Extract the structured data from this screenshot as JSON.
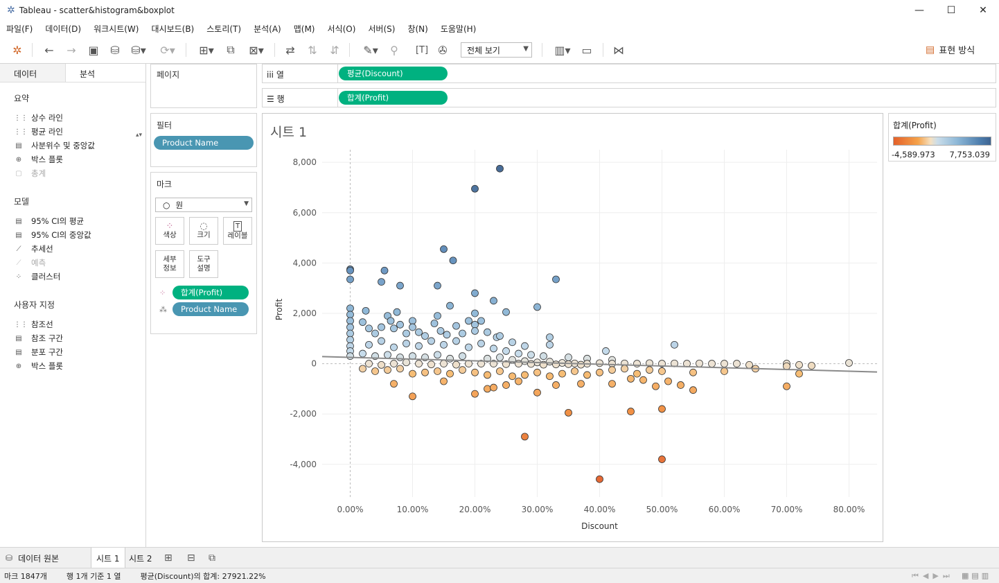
{
  "window": {
    "title": "Tableau - scatter&histogram&boxplot",
    "minimize": "—",
    "maximize": "☐",
    "close": "✕"
  },
  "menu": [
    "파일(F)",
    "데이터(D)",
    "워크시트(W)",
    "대시보드(B)",
    "스토리(T)",
    "분석(A)",
    "맵(M)",
    "서식(O)",
    "서버(S)",
    "창(N)",
    "도움말(H)"
  ],
  "toolbar": {
    "fit_label": "전체 보기",
    "showme_label": "표현 방식"
  },
  "left_pane": {
    "tabs": [
      "데이터",
      "분석"
    ],
    "sections": [
      {
        "title": "요약",
        "items": [
          {
            "label": "상수 라인",
            "enabled": true
          },
          {
            "label": "평균 라인",
            "enabled": true
          },
          {
            "label": "사분위수 및 중앙값",
            "enabled": true
          },
          {
            "label": "박스 플롯",
            "enabled": true
          },
          {
            "label": "총계",
            "enabled": false
          }
        ]
      },
      {
        "title": "모델",
        "items": [
          {
            "label": "95% CI의 평균",
            "enabled": true
          },
          {
            "label": "95% CI의 중앙값",
            "enabled": true
          },
          {
            "label": "추세선",
            "enabled": true
          },
          {
            "label": "예측",
            "enabled": false
          },
          {
            "label": "클러스터",
            "enabled": true
          }
        ]
      },
      {
        "title": "사용자 지정",
        "items": [
          {
            "label": "참조선",
            "enabled": true
          },
          {
            "label": "참조 구간",
            "enabled": true
          },
          {
            "label": "분포 구간",
            "enabled": true
          },
          {
            "label": "박스 플롯",
            "enabled": true
          }
        ]
      }
    ]
  },
  "cards": {
    "pages_title": "페이지",
    "filters_title": "필터",
    "filter_pill": "Product Name",
    "marks_title": "마크",
    "mark_type": "원",
    "mark_buttons": [
      "색상",
      "크기",
      "레이블",
      "세부\n정보",
      "도구\n설명"
    ],
    "mark_pills": [
      "합계(Profit)",
      "Product Name"
    ]
  },
  "shelves": {
    "columns_label": "열",
    "columns_pill": "평균(Discount)",
    "rows_label": "행",
    "rows_pill": "합계(Profit)"
  },
  "sheet": {
    "title": "시트 1"
  },
  "legend": {
    "title": "합계(Profit)",
    "min": "-4,589.973",
    "max": "7,753.039",
    "colors": [
      "#e4612a",
      "#f5a24a",
      "#f5e0c0",
      "#cbdde9",
      "#8fb9d8",
      "#4b7bab",
      "#3e6491"
    ]
  },
  "chart_data": {
    "type": "scatter",
    "xlabel": "Discount",
    "ylabel": "Profit",
    "xlim": [
      -0.045,
      0.845
    ],
    "ylim": [
      -5300,
      8500
    ],
    "x_ticks": [
      "0.00%",
      "10.00%",
      "20.00%",
      "30.00%",
      "40.00%",
      "50.00%",
      "60.00%",
      "70.00%",
      "80.00%"
    ],
    "x_tick_values": [
      0,
      0.1,
      0.2,
      0.3,
      0.4,
      0.5,
      0.6,
      0.7,
      0.8
    ],
    "y_ticks": [
      "8,000",
      "6,000",
      "4,000",
      "2,000",
      "0",
      "-2,000",
      "-4,000"
    ],
    "y_tick_values": [
      8000,
      6000,
      4000,
      2000,
      0,
      -2000,
      -4000
    ],
    "grid": true,
    "trend_line": {
      "x": [
        -0.045,
        0.845
      ],
      "y": [
        280,
        -330
      ]
    },
    "points": [
      [
        0.24,
        7750
      ],
      [
        0.2,
        6950
      ],
      [
        0.15,
        4550
      ],
      [
        0.165,
        4100
      ],
      [
        0.33,
        3350
      ],
      [
        0.0,
        3750
      ],
      [
        0.0,
        3700
      ],
      [
        0.0,
        3350
      ],
      [
        0.055,
        3700
      ],
      [
        0.05,
        3250
      ],
      [
        0.08,
        3100
      ],
      [
        0.14,
        3100
      ],
      [
        0.2,
        2800
      ],
      [
        0.23,
        2500
      ],
      [
        0.3,
        2250
      ],
      [
        0.16,
        2300
      ],
      [
        0.25,
        2050
      ],
      [
        0.52,
        750
      ],
      [
        0.2,
        2000
      ],
      [
        0.0,
        2200
      ],
      [
        0.0,
        1950
      ],
      [
        0.0,
        1700
      ],
      [
        0.0,
        1450
      ],
      [
        0.0,
        1200
      ],
      [
        0.0,
        950
      ],
      [
        0.0,
        700
      ],
      [
        0.0,
        500
      ],
      [
        0.0,
        300
      ],
      [
        0.025,
        2100
      ],
      [
        0.02,
        1650
      ],
      [
        0.03,
        1400
      ],
      [
        0.04,
        1200
      ],
      [
        0.05,
        1450
      ],
      [
        0.06,
        1900
      ],
      [
        0.065,
        1700
      ],
      [
        0.07,
        1400
      ],
      [
        0.075,
        2050
      ],
      [
        0.08,
        1550
      ],
      [
        0.09,
        1200
      ],
      [
        0.1,
        1700
      ],
      [
        0.1,
        1450
      ],
      [
        0.11,
        1250
      ],
      [
        0.12,
        1100
      ],
      [
        0.135,
        1600
      ],
      [
        0.14,
        1900
      ],
      [
        0.145,
        1300
      ],
      [
        0.155,
        1150
      ],
      [
        0.17,
        1500
      ],
      [
        0.18,
        1200
      ],
      [
        0.19,
        1700
      ],
      [
        0.2,
        1550
      ],
      [
        0.2,
        1300
      ],
      [
        0.21,
        1700
      ],
      [
        0.22,
        1250
      ],
      [
        0.235,
        1050
      ],
      [
        0.24,
        1100
      ],
      [
        0.26,
        850
      ],
      [
        0.28,
        700
      ],
      [
        0.32,
        1050
      ],
      [
        0.32,
        750
      ],
      [
        0.41,
        500
      ],
      [
        0.03,
        750
      ],
      [
        0.05,
        900
      ],
      [
        0.07,
        650
      ],
      [
        0.09,
        800
      ],
      [
        0.11,
        700
      ],
      [
        0.13,
        900
      ],
      [
        0.15,
        750
      ],
      [
        0.17,
        900
      ],
      [
        0.19,
        650
      ],
      [
        0.21,
        800
      ],
      [
        0.23,
        600
      ],
      [
        0.25,
        500
      ],
      [
        0.27,
        400
      ],
      [
        0.29,
        350
      ],
      [
        0.31,
        300
      ],
      [
        0.35,
        250
      ],
      [
        0.38,
        200
      ],
      [
        0.42,
        150
      ],
      [
        0.02,
        400
      ],
      [
        0.04,
        300
      ],
      [
        0.06,
        350
      ],
      [
        0.08,
        250
      ],
      [
        0.1,
        300
      ],
      [
        0.12,
        250
      ],
      [
        0.14,
        350
      ],
      [
        0.16,
        200
      ],
      [
        0.18,
        300
      ],
      [
        0.22,
        200
      ],
      [
        0.24,
        250
      ],
      [
        0.26,
        150
      ],
      [
        0.28,
        100
      ],
      [
        0.3,
        50
      ],
      [
        0.32,
        80
      ],
      [
        0.34,
        30
      ],
      [
        0.36,
        10
      ],
      [
        0.38,
        0
      ],
      [
        0.4,
        20
      ],
      [
        0.42,
        0
      ],
      [
        0.44,
        10
      ],
      [
        0.46,
        0
      ],
      [
        0.48,
        20
      ],
      [
        0.5,
        0
      ],
      [
        0.52,
        10
      ],
      [
        0.54,
        0
      ],
      [
        0.56,
        10
      ],
      [
        0.58,
        0
      ],
      [
        0.6,
        0
      ],
      [
        0.62,
        0
      ],
      [
        0.64,
        -50
      ],
      [
        0.7,
        0
      ],
      [
        0.7,
        -100
      ],
      [
        0.72,
        -50
      ],
      [
        0.74,
        -80
      ],
      [
        0.8,
        30
      ],
      [
        0.03,
        0
      ],
      [
        0.05,
        -50
      ],
      [
        0.07,
        0
      ],
      [
        0.09,
        50
      ],
      [
        0.11,
        0
      ],
      [
        0.13,
        -30
      ],
      [
        0.15,
        0
      ],
      [
        0.17,
        -40
      ],
      [
        0.19,
        0
      ],
      [
        0.21,
        0
      ],
      [
        0.23,
        0
      ],
      [
        0.25,
        -20
      ],
      [
        0.27,
        0
      ],
      [
        0.29,
        -10
      ],
      [
        0.31,
        -40
      ],
      [
        0.33,
        -30
      ],
      [
        0.35,
        -20
      ],
      [
        0.37,
        -40
      ],
      [
        0.02,
        -200
      ],
      [
        0.04,
        -300
      ],
      [
        0.06,
        -250
      ],
      [
        0.08,
        -200
      ],
      [
        0.1,
        -400
      ],
      [
        0.12,
        -350
      ],
      [
        0.14,
        -300
      ],
      [
        0.16,
        -400
      ],
      [
        0.18,
        -250
      ],
      [
        0.2,
        -350
      ],
      [
        0.22,
        -450
      ],
      [
        0.24,
        -300
      ],
      [
        0.26,
        -500
      ],
      [
        0.28,
        -450
      ],
      [
        0.3,
        -350
      ],
      [
        0.32,
        -500
      ],
      [
        0.34,
        -400
      ],
      [
        0.36,
        -300
      ],
      [
        0.38,
        -450
      ],
      [
        0.4,
        -350
      ],
      [
        0.42,
        -250
      ],
      [
        0.44,
        -200
      ],
      [
        0.46,
        -400
      ],
      [
        0.48,
        -250
      ],
      [
        0.5,
        -300
      ],
      [
        0.55,
        -350
      ],
      [
        0.6,
        -300
      ],
      [
        0.65,
        -200
      ],
      [
        0.7,
        -900
      ],
      [
        0.72,
        -400
      ],
      [
        0.07,
        -800
      ],
      [
        0.1,
        -1300
      ],
      [
        0.15,
        -700
      ],
      [
        0.2,
        -1200
      ],
      [
        0.22,
        -1000
      ],
      [
        0.23,
        -950
      ],
      [
        0.25,
        -850
      ],
      [
        0.27,
        -700
      ],
      [
        0.3,
        -1150
      ],
      [
        0.33,
        -850
      ],
      [
        0.37,
        -800
      ],
      [
        0.42,
        -800
      ],
      [
        0.45,
        -600
      ],
      [
        0.47,
        -650
      ],
      [
        0.49,
        -900
      ],
      [
        0.51,
        -700
      ],
      [
        0.53,
        -850
      ],
      [
        0.55,
        -1050
      ],
      [
        0.35,
        -1950
      ],
      [
        0.45,
        -1900
      ],
      [
        0.5,
        -1800
      ],
      [
        0.28,
        -2900
      ],
      [
        0.5,
        -3800
      ],
      [
        0.4,
        -4590
      ]
    ]
  },
  "sheet_tabs": {
    "data_source": "데이터 원본",
    "tabs": [
      "시트 1",
      "시트 2"
    ]
  },
  "status": {
    "marks": "마크 1847개",
    "dims": "행 1개 기준 1 열",
    "sum": "평균(Discount)의 합계: 27921.22%"
  }
}
